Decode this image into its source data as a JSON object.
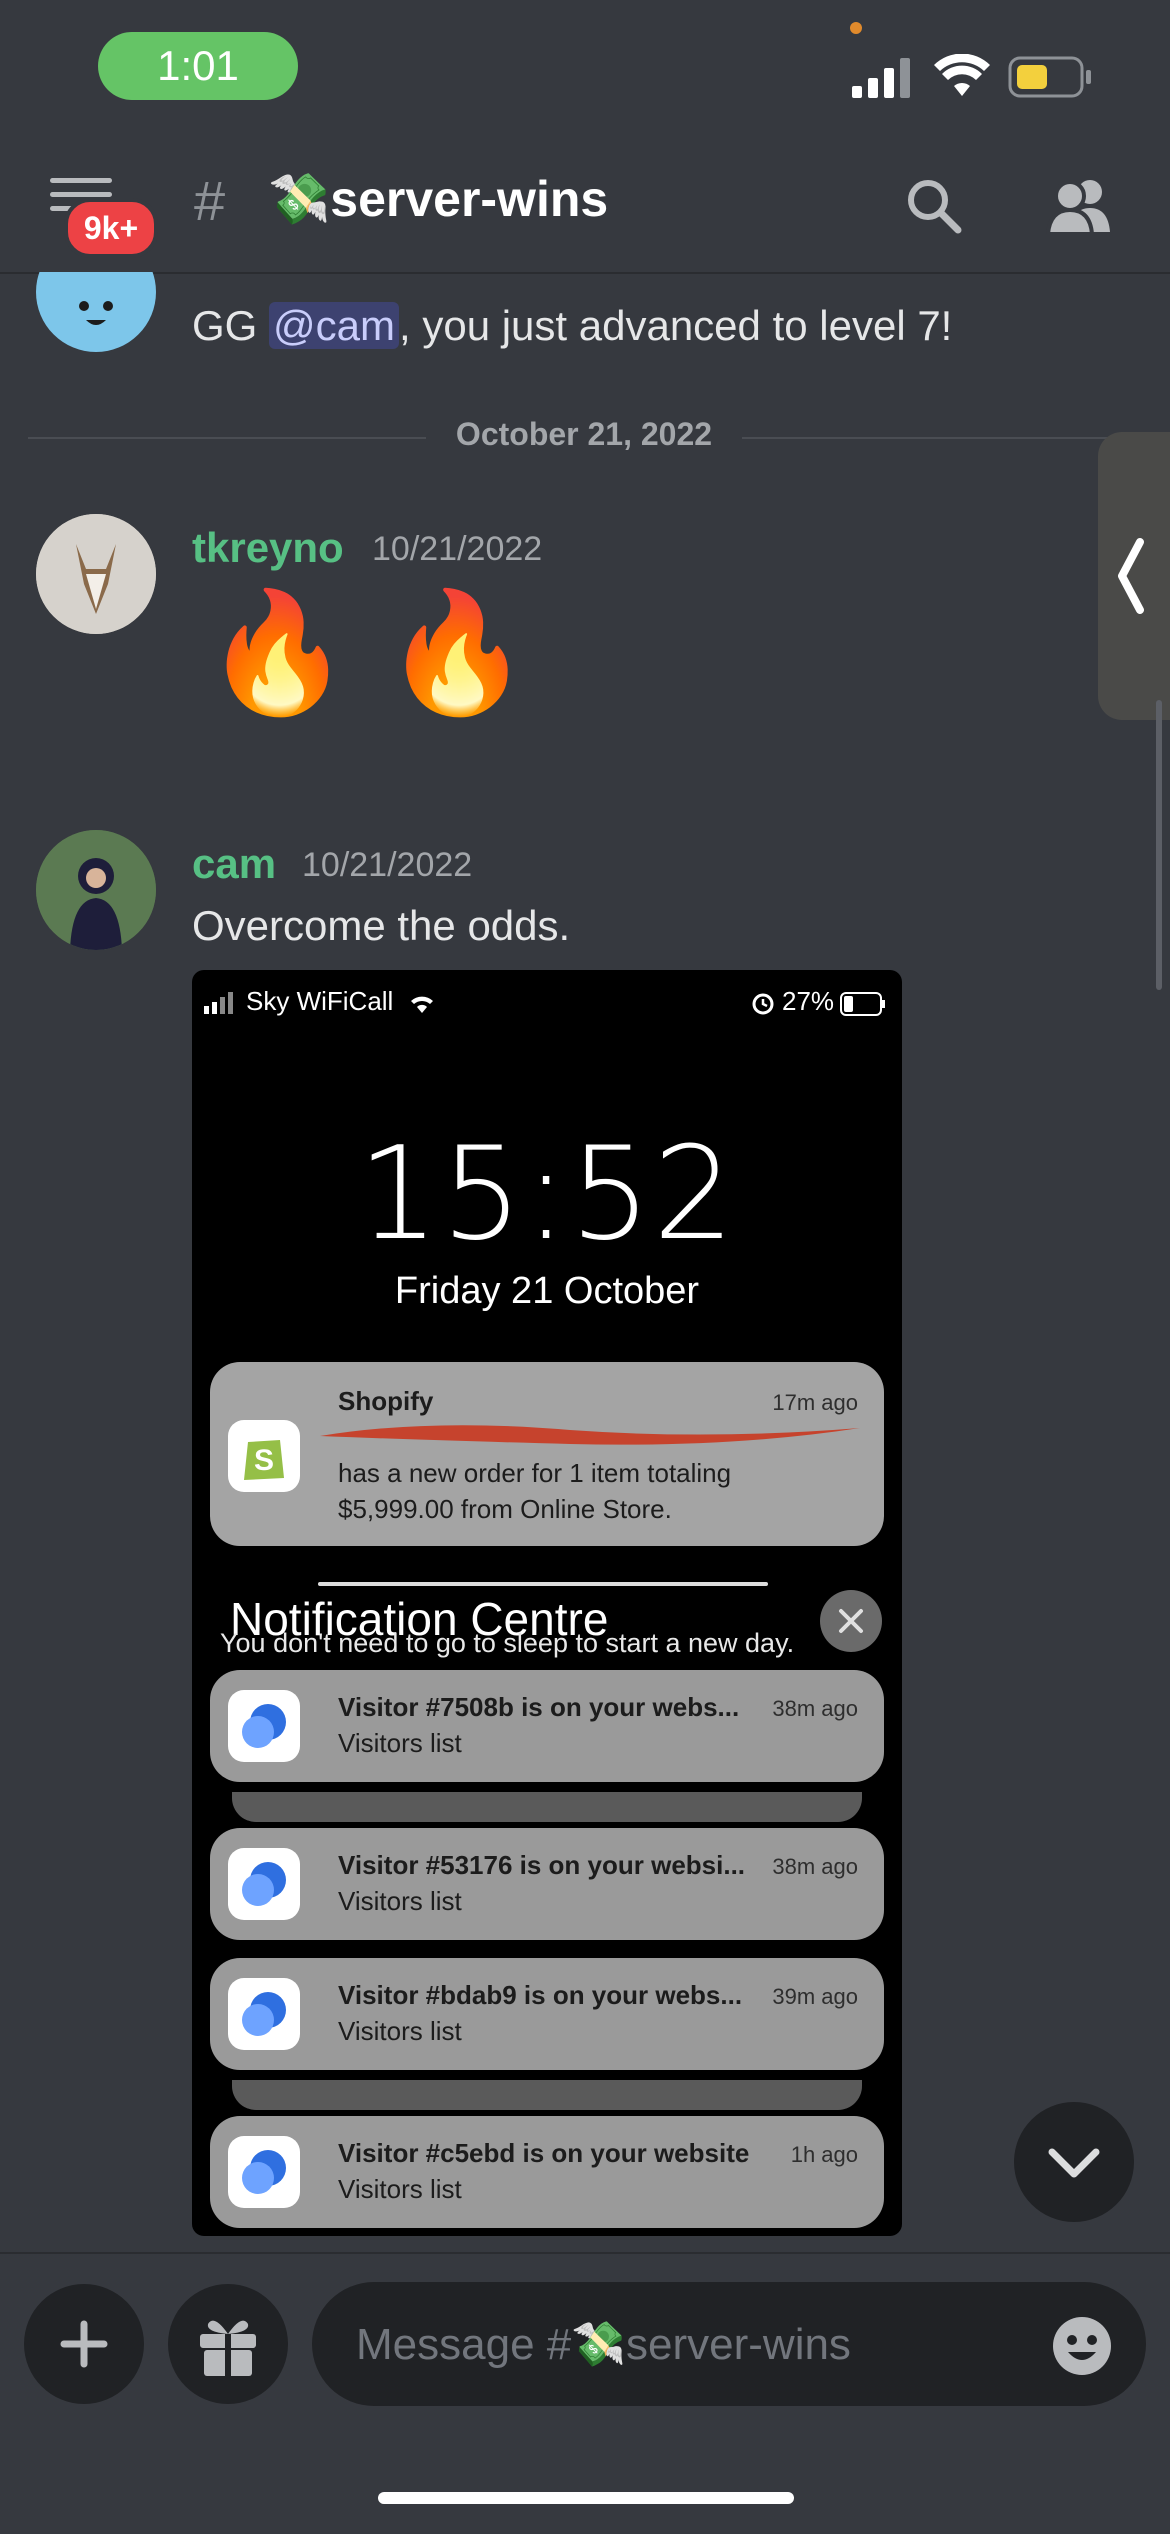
{
  "status_bar": {
    "time": "1:01"
  },
  "header": {
    "unread_badge": "9k+",
    "channel_name": "💸server-wins"
  },
  "messages": [
    {
      "author": "",
      "timestamp": "",
      "text_before": "GG ",
      "mention": "@cam",
      "text_after": ", you just advanced to level 7!"
    },
    {
      "divider": "October 21, 2022"
    },
    {
      "author": "tkreyno",
      "timestamp": "10/21/2022",
      "emoji": "🔥 🔥"
    },
    {
      "author": "cam",
      "timestamp": "10/21/2022",
      "text": "Overcome the odds."
    }
  ],
  "attachment": {
    "carrier": "Sky WiFiCall",
    "battery": "27%",
    "clock": "15:52",
    "date": "Friday 21 October",
    "shopify": {
      "app": "Shopify",
      "time": "17m ago",
      "line1": "has a new order for 1 item totaling",
      "line2": "$5,999.00 from Online Store."
    },
    "notification_centre": {
      "title": "Notification Centre",
      "subtitle": "You don't need to go to sleep to start a new day."
    },
    "visitor_notifications": [
      {
        "title": "Visitor #7508b is on your webs...",
        "sub": "Visitors list",
        "time": "38m ago"
      },
      {
        "title": "Visitor #53176 is on your websi...",
        "sub": "Visitors list",
        "time": "38m ago"
      },
      {
        "title": "Visitor #bdab9 is on your webs...",
        "sub": "Visitors list",
        "time": "39m ago"
      },
      {
        "title": "Visitor #c5ebd is on your website",
        "sub": "Visitors list",
        "time": "1h ago"
      }
    ]
  },
  "composer": {
    "placeholder": "Message #💸server-wins"
  },
  "colors": {
    "background": "#36393f",
    "username_green": "#57c084",
    "badge_red": "#ed4245",
    "time_pill_green": "#65c466"
  }
}
